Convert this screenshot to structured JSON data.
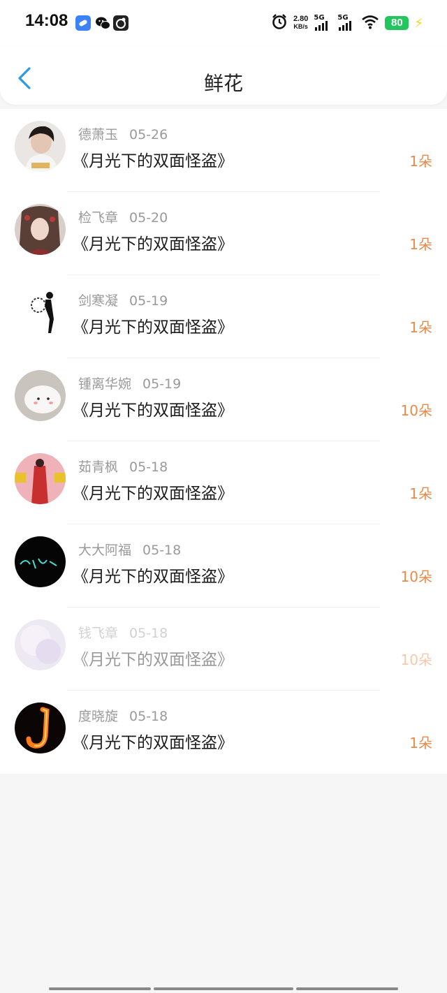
{
  "status": {
    "time": "14:08",
    "speed_value": "2.80",
    "speed_unit": "KB/s",
    "net1": "5G",
    "net2": "5G",
    "battery": "80",
    "icons": [
      "blue-app-icon",
      "wechat-icon",
      "gallery-app-icon",
      "alarm-icon",
      "wifi-icon",
      "charging-icon"
    ]
  },
  "nav": {
    "title": "鲜花",
    "back_icon": "chevron-left-icon"
  },
  "items": [
    {
      "user": "德萧玉",
      "date": "05-26",
      "book": "《月光下的双面怪盗》",
      "count": "1朵"
    },
    {
      "user": "检飞章",
      "date": "05-20",
      "book": "《月光下的双面怪盗》",
      "count": "1朵"
    },
    {
      "user": "剑寒凝",
      "date": "05-19",
      "book": "《月光下的双面怪盗》",
      "count": "1朵"
    },
    {
      "user": "锺离华婉",
      "date": "05-19",
      "book": "《月光下的双面怪盗》",
      "count": "10朵"
    },
    {
      "user": "茹青枫",
      "date": "05-18",
      "book": "《月光下的双面怪盗》",
      "count": "1朵"
    },
    {
      "user": "大大阿福",
      "date": "05-18",
      "book": "《月光下的双面怪盗》",
      "count": "10朵"
    },
    {
      "user": "钱飞章",
      "date": "05-18",
      "book": "《月光下的双面怪盗》",
      "count": "10朵"
    },
    {
      "user": "度晓旋",
      "date": "05-18",
      "book": "《月光下的双面怪盗》",
      "count": "1朵"
    }
  ],
  "colors": {
    "accent": "#e78a4b",
    "nav_back": "#2d9ae6",
    "battery": "#22c55e"
  }
}
